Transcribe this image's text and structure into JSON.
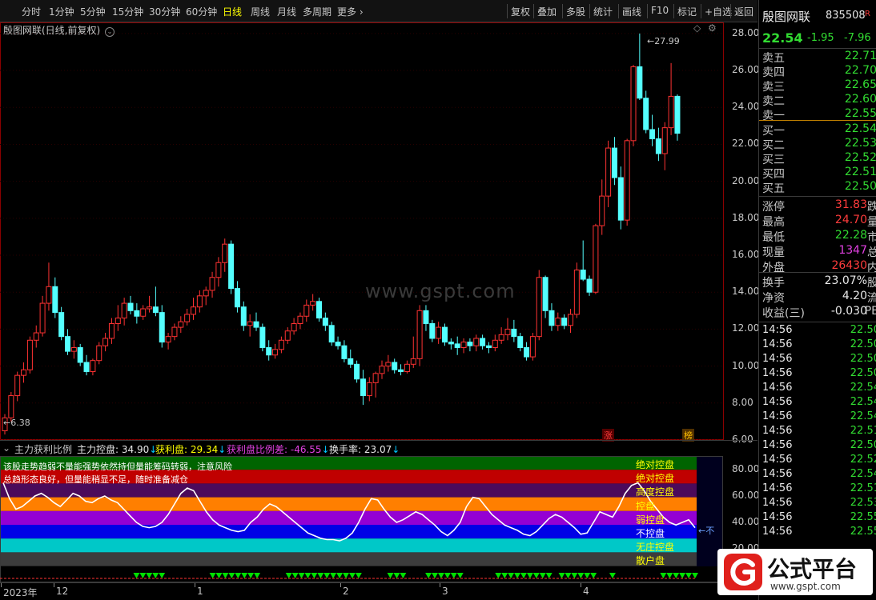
{
  "toolbar": {
    "periods": [
      "分时",
      "1分钟",
      "5分钟",
      "15分钟",
      "30分钟",
      "60分钟",
      "日线",
      "周线",
      "月线",
      "多周期",
      "更多"
    ],
    "active": "日线",
    "right_buttons": [
      "复权",
      "叠加",
      "多股",
      "统计",
      "画线",
      "F10",
      "标记",
      "+自选",
      "返回"
    ]
  },
  "chart": {
    "title": "殷图网联(日线,前复权)",
    "high_label": "27.99",
    "low_label": "6.38",
    "watermark": "www.gspt.com",
    "badge_zhang": "涨",
    "badge_bang": "榜",
    "y_ticks": [
      "28.00",
      "26.00",
      "24.00",
      "22.00",
      "20.00",
      "18.00",
      "16.00",
      "14.00",
      "12.00",
      "10.00",
      "8.00",
      "6.00"
    ],
    "x_labels": [
      "2023年",
      "12",
      "1",
      "2",
      "3",
      "4"
    ]
  },
  "chart_data": {
    "type": "candlestick",
    "ylim": [
      6,
      28.6
    ],
    "ohlc": [
      [
        6.5,
        7.4,
        6.3,
        7.2
      ],
      [
        7.2,
        8.6,
        7.0,
        8.4
      ],
      [
        8.4,
        9.7,
        8.1,
        9.5
      ],
      [
        9.5,
        10.2,
        9.1,
        9.8
      ],
      [
        9.8,
        11.6,
        9.6,
        11.4
      ],
      [
        11.4,
        12.2,
        11.0,
        11.8
      ],
      [
        11.8,
        13.8,
        11.6,
        13.4
      ],
      [
        13.4,
        15.6,
        13.0,
        14.3
      ],
      [
        14.3,
        14.8,
        12.6,
        12.9
      ],
      [
        12.9,
        13.2,
        11.4,
        11.6
      ],
      [
        11.6,
        12.0,
        10.6,
        10.8
      ],
      [
        10.8,
        11.4,
        10.4,
        11.0
      ],
      [
        11.0,
        11.2,
        10.0,
        10.2
      ],
      [
        10.2,
        10.6,
        9.5,
        9.7
      ],
      [
        9.7,
        10.4,
        9.5,
        10.3
      ],
      [
        10.3,
        11.3,
        10.1,
        11.1
      ],
      [
        11.1,
        11.8,
        10.8,
        11.5
      ],
      [
        11.5,
        12.6,
        11.2,
        12.3
      ],
      [
        12.3,
        13.3,
        11.9,
        12.6
      ],
      [
        12.6,
        13.7,
        12.2,
        13.4
      ],
      [
        13.4,
        13.8,
        12.8,
        13.0
      ],
      [
        13.0,
        13.4,
        12.3,
        12.7
      ],
      [
        12.7,
        13.3,
        12.5,
        13.1
      ],
      [
        13.1,
        13.8,
        12.9,
        13.2
      ],
      [
        13.2,
        14.3,
        12.7,
        12.9
      ],
      [
        12.9,
        13.3,
        11.0,
        11.3
      ],
      [
        11.3,
        11.8,
        10.9,
        11.6
      ],
      [
        11.6,
        12.3,
        11.4,
        12.1
      ],
      [
        12.1,
        12.7,
        11.8,
        12.4
      ],
      [
        12.4,
        13.1,
        12.2,
        12.8
      ],
      [
        12.8,
        13.7,
        12.5,
        13.2
      ],
      [
        13.2,
        14.1,
        12.9,
        13.8
      ],
      [
        13.8,
        14.3,
        13.3,
        14.1
      ],
      [
        14.1,
        15.1,
        13.7,
        14.8
      ],
      [
        14.8,
        15.9,
        14.3,
        15.6
      ],
      [
        15.6,
        16.9,
        15.1,
        16.6
      ],
      [
        16.6,
        16.8,
        13.9,
        14.2
      ],
      [
        14.2,
        14.6,
        12.9,
        13.2
      ],
      [
        13.2,
        13.5,
        11.9,
        12.2
      ],
      [
        12.2,
        12.8,
        11.6,
        12.4
      ],
      [
        12.4,
        12.9,
        11.9,
        12.1
      ],
      [
        12.1,
        12.3,
        10.8,
        11.0
      ],
      [
        11.0,
        11.4,
        10.3,
        10.6
      ],
      [
        10.6,
        11.2,
        10.4,
        10.9
      ],
      [
        10.9,
        11.6,
        10.7,
        11.4
      ],
      [
        11.4,
        12.1,
        11.2,
        11.9
      ],
      [
        11.9,
        12.6,
        11.7,
        12.3
      ],
      [
        12.3,
        12.9,
        12.0,
        12.7
      ],
      [
        12.7,
        13.6,
        12.4,
        13.3
      ],
      [
        13.3,
        13.9,
        13.0,
        13.5
      ],
      [
        13.5,
        13.7,
        12.4,
        12.6
      ],
      [
        12.6,
        12.9,
        11.9,
        12.2
      ],
      [
        12.2,
        12.4,
        11.1,
        11.3
      ],
      [
        11.3,
        11.6,
        10.9,
        11.1
      ],
      [
        11.1,
        11.4,
        10.2,
        10.4
      ],
      [
        10.4,
        10.9,
        9.9,
        10.1
      ],
      [
        10.1,
        10.3,
        9.1,
        9.3
      ],
      [
        9.3,
        9.8,
        7.9,
        8.4
      ],
      [
        8.4,
        9.4,
        8.1,
        9.1
      ],
      [
        9.1,
        9.7,
        8.3,
        9.6
      ],
      [
        9.6,
        10.3,
        9.3,
        10.0
      ],
      [
        10.0,
        10.6,
        9.7,
        10.2
      ],
      [
        10.2,
        10.4,
        9.6,
        9.8
      ],
      [
        9.8,
        10.1,
        9.5,
        9.7
      ],
      [
        9.7,
        10.3,
        9.6,
        10.1
      ],
      [
        10.1,
        11.6,
        9.9,
        10.4
      ],
      [
        10.4,
        13.3,
        10.0,
        13.0
      ],
      [
        13.0,
        13.3,
        11.9,
        12.3
      ],
      [
        12.3,
        12.5,
        11.3,
        11.5
      ],
      [
        11.5,
        12.4,
        11.2,
        12.1
      ],
      [
        12.1,
        12.3,
        11.1,
        11.3
      ],
      [
        11.3,
        11.5,
        10.9,
        11.2
      ],
      [
        11.2,
        11.6,
        10.6,
        11.0
      ],
      [
        11.0,
        11.5,
        10.7,
        11.3
      ],
      [
        11.3,
        11.5,
        10.8,
        11.1
      ],
      [
        11.1,
        11.7,
        10.8,
        11.5
      ],
      [
        11.5,
        11.7,
        10.9,
        11.1
      ],
      [
        11.1,
        11.3,
        10.7,
        11.0
      ],
      [
        11.0,
        11.7,
        10.8,
        11.4
      ],
      [
        11.4,
        12.1,
        11.2,
        11.7
      ],
      [
        11.7,
        12.6,
        11.4,
        12.0
      ],
      [
        12.0,
        12.5,
        11.3,
        11.6
      ],
      [
        11.6,
        11.8,
        10.8,
        11.0
      ],
      [
        11.0,
        11.3,
        10.3,
        10.5
      ],
      [
        10.5,
        11.8,
        10.3,
        11.6
      ],
      [
        11.6,
        15.2,
        11.4,
        14.8
      ],
      [
        14.8,
        14.9,
        12.6,
        13.0
      ],
      [
        13.0,
        13.4,
        11.9,
        12.2
      ],
      [
        12.2,
        12.9,
        11.9,
        12.6
      ],
      [
        12.6,
        12.8,
        12.0,
        12.2
      ],
      [
        12.2,
        13.1,
        11.8,
        12.8
      ],
      [
        12.8,
        15.6,
        12.6,
        15.2
      ],
      [
        15.2,
        16.8,
        14.6,
        14.7
      ],
      [
        14.7,
        14.9,
        13.8,
        14.0
      ],
      [
        14.0,
        17.7,
        13.9,
        17.6
      ],
      [
        17.6,
        20.1,
        17.1,
        19.2
      ],
      [
        19.2,
        22.2,
        18.6,
        21.8
      ],
      [
        21.8,
        22.4,
        19.8,
        20.2
      ],
      [
        20.2,
        20.8,
        17.4,
        17.9
      ],
      [
        17.9,
        22.3,
        17.6,
        22.2
      ],
      [
        22.2,
        26.3,
        21.9,
        26.2
      ],
      [
        26.2,
        28.0,
        24.4,
        24.5
      ],
      [
        24.5,
        24.9,
        22.6,
        22.8
      ],
      [
        22.8,
        23.6,
        21.9,
        22.3
      ],
      [
        22.3,
        22.9,
        21.1,
        21.5
      ],
      [
        21.5,
        23.2,
        20.6,
        22.9
      ],
      [
        22.9,
        26.4,
        22.5,
        24.6
      ],
      [
        24.6,
        24.7,
        22.2,
        22.6
      ]
    ]
  },
  "indicator": {
    "name": "主力获利比例",
    "items": [
      {
        "label": "主力控盘: 34.90",
        "arrow": "↓",
        "color": "#e8e8e8"
      },
      {
        "label": "获利盘: 29.34",
        "arrow": "↓",
        "color": "#ffff00"
      },
      {
        "label": "获利盘比例差: -46.55",
        "arrow": "↓",
        "color": "#e040e0"
      },
      {
        "label": "换手率: 23.07",
        "arrow": "↓",
        "color": "#e8e8e8"
      }
    ],
    "note1": "该股走势趋弱不量能强势依然持但量能筹码转弱，注意风险",
    "note2": "总趋形态良好，但量能稍显不足，随时准备减仓",
    "bands": [
      {
        "label": "绝对控盘",
        "color": "#006400",
        "text_color": "#ffff00"
      },
      {
        "label": "绝对控盘",
        "color": "#c00000",
        "text_color": "#ffff00"
      },
      {
        "label": "高度控盘",
        "color": "#4b0a5a",
        "text_color": "#ffff00"
      },
      {
        "label": "控盘",
        "color": "#ff7f00",
        "text_color": "#ffff00"
      },
      {
        "label": "弱控盘",
        "color": "#9400d3",
        "text_color": "#ffff00"
      },
      {
        "label": "不控盘",
        "color": "#0000e6",
        "text_color": "#ffffff"
      },
      {
        "label": "无庄控盘",
        "color": "#00c8c8",
        "text_color": "#ffff00"
      },
      {
        "label": "散户盘",
        "color": "#3c3c3c",
        "text_color": "#ffff00"
      }
    ],
    "y_ticks": [
      "80.00",
      "60.00",
      "40.00",
      "20.00"
    ],
    "end_label": "←不"
  },
  "indicator_series": [
    70,
    58,
    50,
    52,
    56,
    60,
    62,
    59,
    55,
    52,
    57,
    62,
    60,
    56,
    55,
    58,
    60,
    57,
    55,
    50,
    45,
    40,
    37,
    36,
    37,
    40,
    46,
    54,
    62,
    66,
    64,
    56,
    48,
    42,
    38,
    36,
    34,
    33,
    34,
    40,
    44,
    50,
    54,
    52,
    48,
    44,
    40,
    36,
    32,
    30,
    28,
    27,
    27,
    26,
    28,
    32,
    40,
    50,
    58,
    57,
    50,
    44,
    40,
    42,
    45,
    48,
    46,
    42,
    38,
    33,
    30,
    34,
    40,
    52,
    59,
    58,
    52,
    46,
    42,
    38,
    36,
    34,
    31,
    30,
    33,
    38,
    43,
    46,
    44,
    40,
    36,
    31,
    32,
    40,
    48,
    46,
    44,
    52,
    62,
    68,
    70,
    64,
    56,
    50,
    44,
    40,
    38,
    40,
    42,
    36
  ],
  "quote": {
    "name": "殷图网联",
    "code": "835508",
    "badge": "R",
    "price": "22.54",
    "change": "-1.95",
    "change_pct": "-7.96",
    "asks": [
      {
        "label": "卖五",
        "value": "22.71"
      },
      {
        "label": "卖四",
        "value": "22.70"
      },
      {
        "label": "卖三",
        "value": "22.65"
      },
      {
        "label": "卖二",
        "value": "22.60"
      },
      {
        "label": "卖一",
        "value": "22.55"
      }
    ],
    "bids": [
      {
        "label": "买一",
        "value": "22.54"
      },
      {
        "label": "买二",
        "value": "22.53"
      },
      {
        "label": "买三",
        "value": "22.52"
      },
      {
        "label": "买四",
        "value": "22.51"
      },
      {
        "label": "买五",
        "value": "22.50"
      }
    ],
    "stats": [
      {
        "label": "涨停",
        "value": "31.83",
        "suffix": "跌",
        "color": "red"
      },
      {
        "label": "最高",
        "value": "24.70",
        "suffix": "量",
        "color": "red"
      },
      {
        "label": "最低",
        "value": "22.28",
        "suffix": "市",
        "color": "green"
      },
      {
        "label": "现量",
        "value": "1347",
        "suffix": "总",
        "color": "magenta"
      },
      {
        "label": "外盘",
        "value": "26430",
        "suffix": "内",
        "color": "red"
      }
    ],
    "stats2": [
      {
        "label": "换手",
        "value": "23.07%",
        "suffix": "股"
      },
      {
        "label": "净资",
        "value": "4.20",
        "suffix": "流"
      },
      {
        "label": "收益(三)",
        "value": "-0.030",
        "suffix": "PE"
      }
    ],
    "ticks": [
      {
        "time": "14:56",
        "price": "22.50"
      },
      {
        "time": "14:56",
        "price": "22.50"
      },
      {
        "time": "14:56",
        "price": "22.50"
      },
      {
        "time": "14:56",
        "price": "22.50"
      },
      {
        "time": "14:56",
        "price": "22.54"
      },
      {
        "time": "14:56",
        "price": "22.54"
      },
      {
        "time": "14:56",
        "price": "22.54"
      },
      {
        "time": "14:56",
        "price": "22.51"
      },
      {
        "time": "14:56",
        "price": "22.50"
      },
      {
        "time": "14:56",
        "price": "22.52"
      },
      {
        "time": "14:56",
        "price": "22.54"
      },
      {
        "time": "14:56",
        "price": "22.51"
      },
      {
        "time": "14:56",
        "price": "22.53"
      },
      {
        "time": "14:56",
        "price": "22.55"
      },
      {
        "time": "14:56",
        "price": "22.55"
      }
    ]
  },
  "logo": {
    "text": "公式平台",
    "url_text": "www.gspt.com"
  }
}
